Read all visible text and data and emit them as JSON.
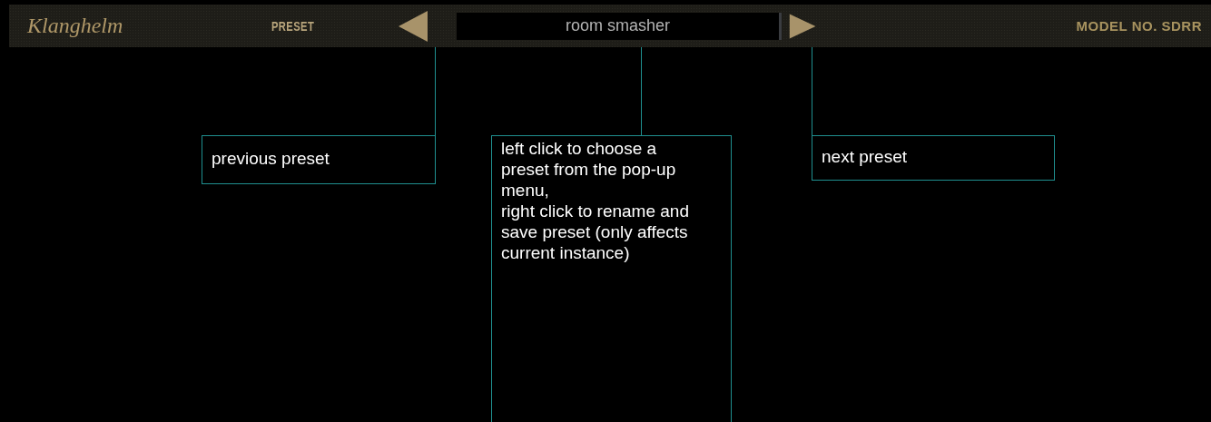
{
  "header": {
    "logo": "Klanghelm",
    "preset_label": "PRESET",
    "preset_name": "room smasher",
    "model": "MODEL NO. SDRR"
  },
  "callouts": [
    {
      "kind": "prev",
      "text": "previous preset"
    },
    {
      "kind": "display",
      "text": "left click to choose a preset from the pop-up menu,\nright click to rename and save preset (only affects current instance)"
    },
    {
      "kind": "next",
      "text": "next preset"
    }
  ]
}
